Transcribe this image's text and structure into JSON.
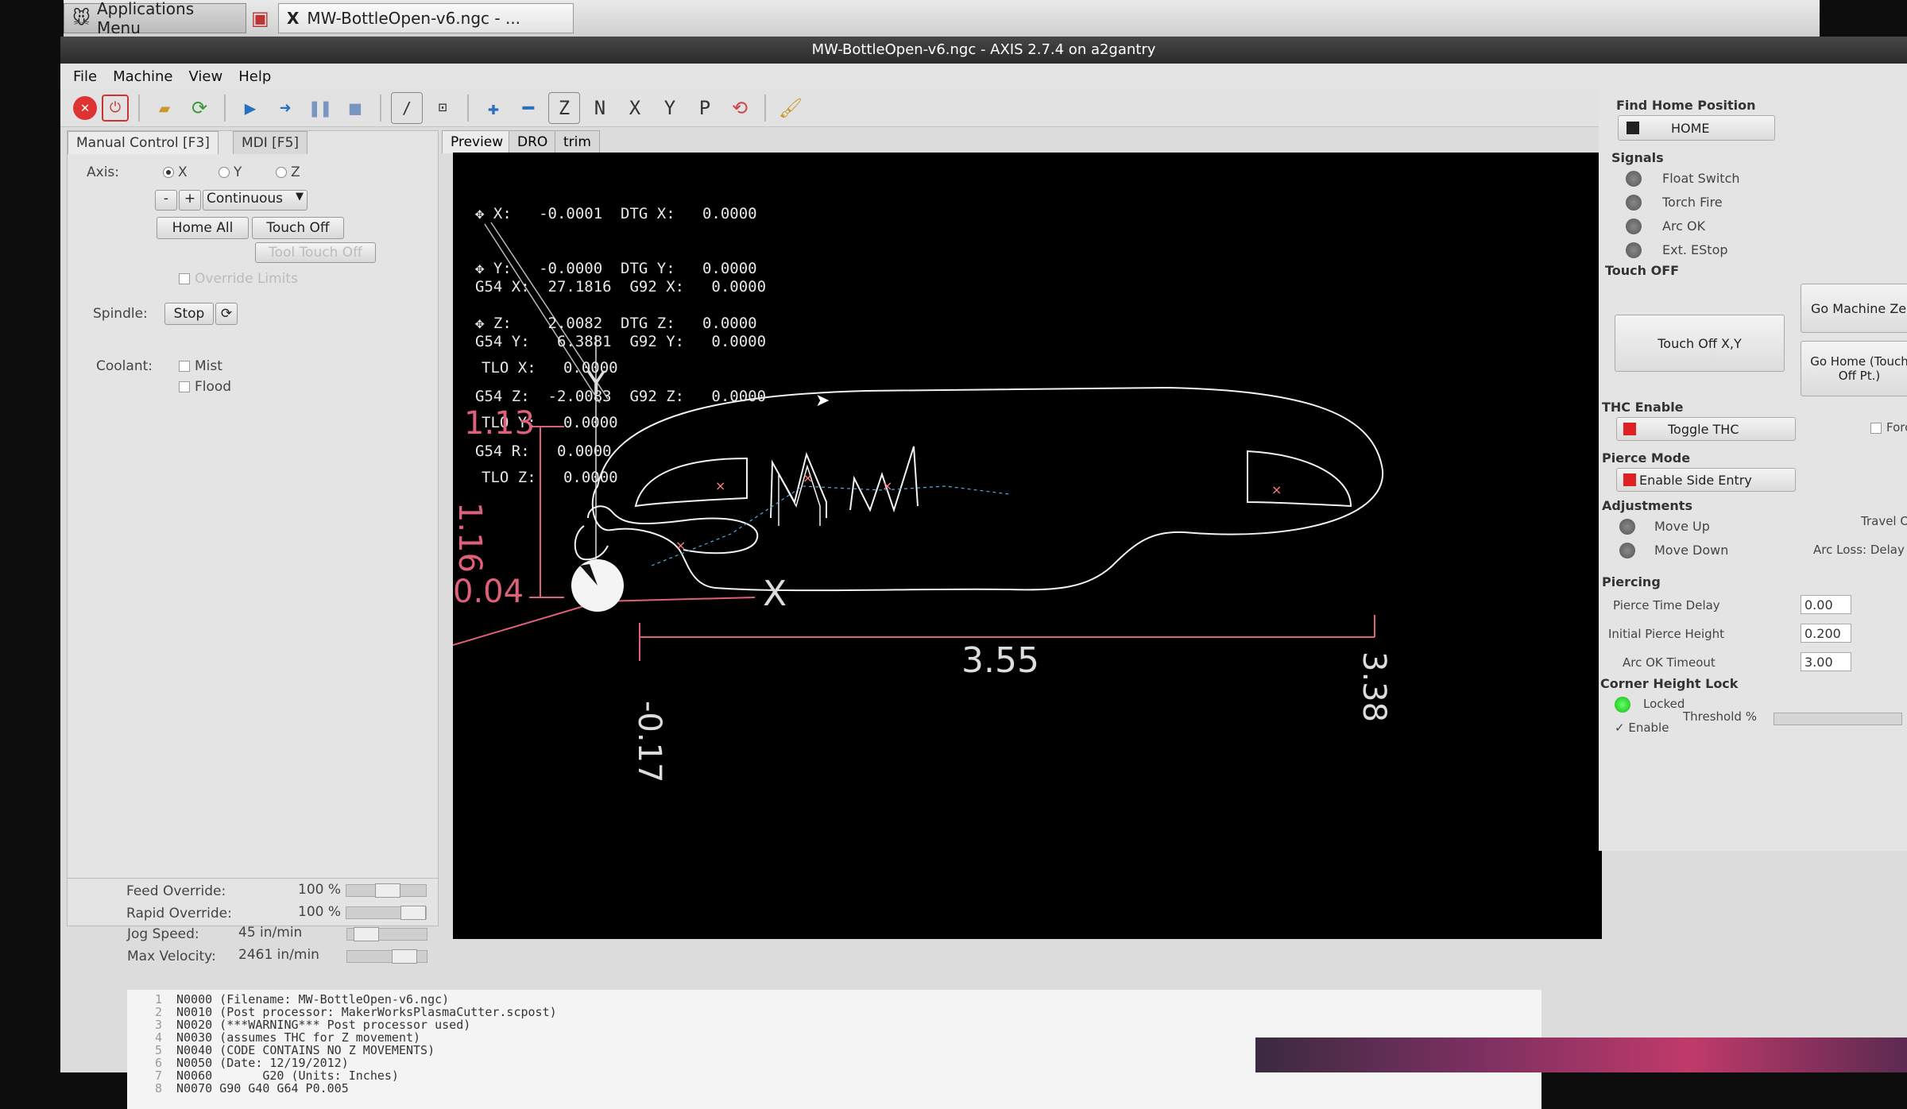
{
  "desktop": {
    "applications_menu": "Applications Menu",
    "task_window": "MW-BottleOpen-v6.ngc - ..."
  },
  "window": {
    "title": "MW-BottleOpen-v6.ngc - AXIS 2.7.4 on a2gantry"
  },
  "menu": [
    "File",
    "Machine",
    "View",
    "Help"
  ],
  "left": {
    "tabs": [
      "Manual Control [F3]",
      "MDI [F5]"
    ],
    "axis_label": "Axis:",
    "axes": [
      "X",
      "Y",
      "Z"
    ],
    "minus": "-",
    "plus": "+",
    "jog_mode": "Continuous",
    "home_all": "Home All",
    "touch_off": "Touch Off",
    "tool_touch_off": "Tool Touch Off",
    "override_limits": "Override Limits",
    "spindle_label": "Spindle:",
    "spindle_stop": "Stop",
    "coolant_label": "Coolant:",
    "mist": "Mist",
    "flood": "Flood",
    "feed_override_label": "Feed Override:",
    "feed_override_value": "100 %",
    "rapid_override_label": "Rapid Override:",
    "rapid_override_value": "100 %",
    "jog_speed_label": "Jog Speed:",
    "jog_speed_value": "45 in/min",
    "max_velocity_label": "Max Velocity:",
    "max_velocity_value": "2461 in/min"
  },
  "view_tabs": [
    "Preview",
    "DRO",
    "trim"
  ],
  "dro": {
    "lines": [
      "X:   -0.0001  DTG X:   0.0000",
      "Y:   -0.0000  DTG Y:   0.0000",
      "Z:    2.0082  DTG Z:   0.0000",
      "G54 X:  27.1816  G92 X:   0.0000",
      "G54 Y:   6.3881  G92 Y:   0.0000",
      "G54 Z:  -2.0083  G92 Z:   0.0000",
      "G54 R:   0.0000",
      "TLO X:   0.0000",
      "TLO Y:   0.0000",
      "TLO Z:   0.0000"
    ]
  },
  "preview": {
    "axis_letter_y": "Y",
    "axis_letter_x": "X",
    "dim_top": "1.13",
    "dim_height": "1.16",
    "dim_left": "0.04",
    "dim_width": "3.55",
    "dim_right": "3.38",
    "dim_bottom": "-0.17",
    "dim_color": "#e0607a",
    "path_color": "#f2f2f2"
  },
  "right": {
    "find_home_title": "Find Home Position",
    "home_button": "HOME",
    "signals_title": "Signals",
    "signals": [
      "Float Switch",
      "Torch Fire",
      "Arc OK",
      "Ext. EStop"
    ],
    "touch_off_title": "Touch OFF",
    "touch_off_xy": "Touch Off X,Y",
    "go_machine_zero": "Go Machine Ze",
    "go_home": "Go Home (Touch Off Pt.)",
    "thc_title": "THC Enable",
    "toggle_thc": "Toggle THC",
    "force_thc": "Force THC Of",
    "pierce_mode_title": "Pierce Mode",
    "enable_side_entry": "Enable Side Entry",
    "adjustments_title": "Adjustments",
    "move_up": "Move Up",
    "move_down": "Move Down",
    "travel_offset": "Travel Offset",
    "arc_loss": "Arc Loss: Delay Before St",
    "piercing_title": "Piercing",
    "pierce_time_delay_label": "Pierce Time Delay",
    "pierce_time_delay": "0.00",
    "initial_pierce_height_label": "Initial Pierce Height",
    "initial_pierce_height": "0.200",
    "arc_ok_timeout_label": "Arc OK Timeout",
    "arc_ok_timeout": "3.00",
    "corner_title": "Corner Height Lock",
    "locked": "Locked",
    "enable": "Enable",
    "threshold": "Threshold %"
  },
  "gcode": [
    {
      "n": "1",
      "text": "N0000 (Filename: MW-BottleOpen-v6.ngc)"
    },
    {
      "n": "2",
      "text": "N0010 (Post processor: MakerWorksPlasmaCutter.scpost)"
    },
    {
      "n": "3",
      "text": "N0020 (***WARNING*** Post processor used)"
    },
    {
      "n": "4",
      "text": "N0030 (assumes THC for Z movement)"
    },
    {
      "n": "5",
      "text": "N0040 (CODE CONTAINS NO Z MOVEMENTS)"
    },
    {
      "n": "6",
      "text": "N0050 (Date: 12/19/2012)"
    },
    {
      "n": "7",
      "text": "N0060       G20 (Units: Inches)"
    },
    {
      "n": "8",
      "text": "N0070 G90 G40 G64 P0.005"
    }
  ]
}
